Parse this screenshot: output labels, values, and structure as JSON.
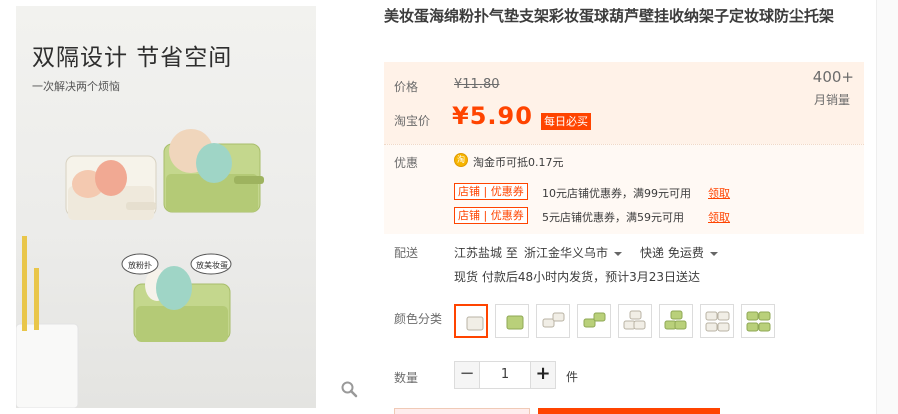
{
  "gallery": {
    "headline": "双隔设计 节省空间",
    "subline": "一次解决两个烦恼",
    "bubble_left": "放粉扑",
    "bubble_right": "放美妆蛋",
    "zoom_icon": "magnifier-icon"
  },
  "product": {
    "title": "美妆蛋海绵粉扑气垫支架彩妆蛋球葫芦壁挂收纳架子定妆球防尘托架"
  },
  "price": {
    "label": "价格",
    "original": "¥11.80",
    "tb_label": "淘宝价",
    "current": "¥5.90",
    "badge": "每日必买",
    "sales_count": "400+",
    "sales_label": "月销量",
    "accent_color": "#ff4400"
  },
  "promo": {
    "label": "优惠",
    "coin_icon": "taobao-coin-icon",
    "coin_glyph": "淘",
    "coin_text": "淘金币可抵0.17元",
    "coupons": [
      {
        "tag": "店铺 | 优惠券",
        "text": "10元店铺优惠券，满99元可用",
        "link": "领取"
      },
      {
        "tag": "店铺 | 优惠券",
        "text": "5元店铺优惠券，满59元可用",
        "link": "领取"
      }
    ]
  },
  "shipping": {
    "label": "配送",
    "from": "江苏盐城 至",
    "to": "浙江金华义乌市",
    "method": "快递 免运费",
    "note": "现货 付款后48小时内发货，预计3月23日送达"
  },
  "color": {
    "label": "颜色分类",
    "options": [
      "white-single",
      "green-single",
      "white-double",
      "green-double",
      "white-triple",
      "green-triple",
      "white-quad",
      "green-quad"
    ],
    "selected_index": 0,
    "colors": {
      "white": "#f1eee6",
      "green": "#b9d07a"
    }
  },
  "quantity": {
    "label": "数量",
    "minus": "−",
    "value": "1",
    "plus": "+",
    "unit": "件"
  }
}
